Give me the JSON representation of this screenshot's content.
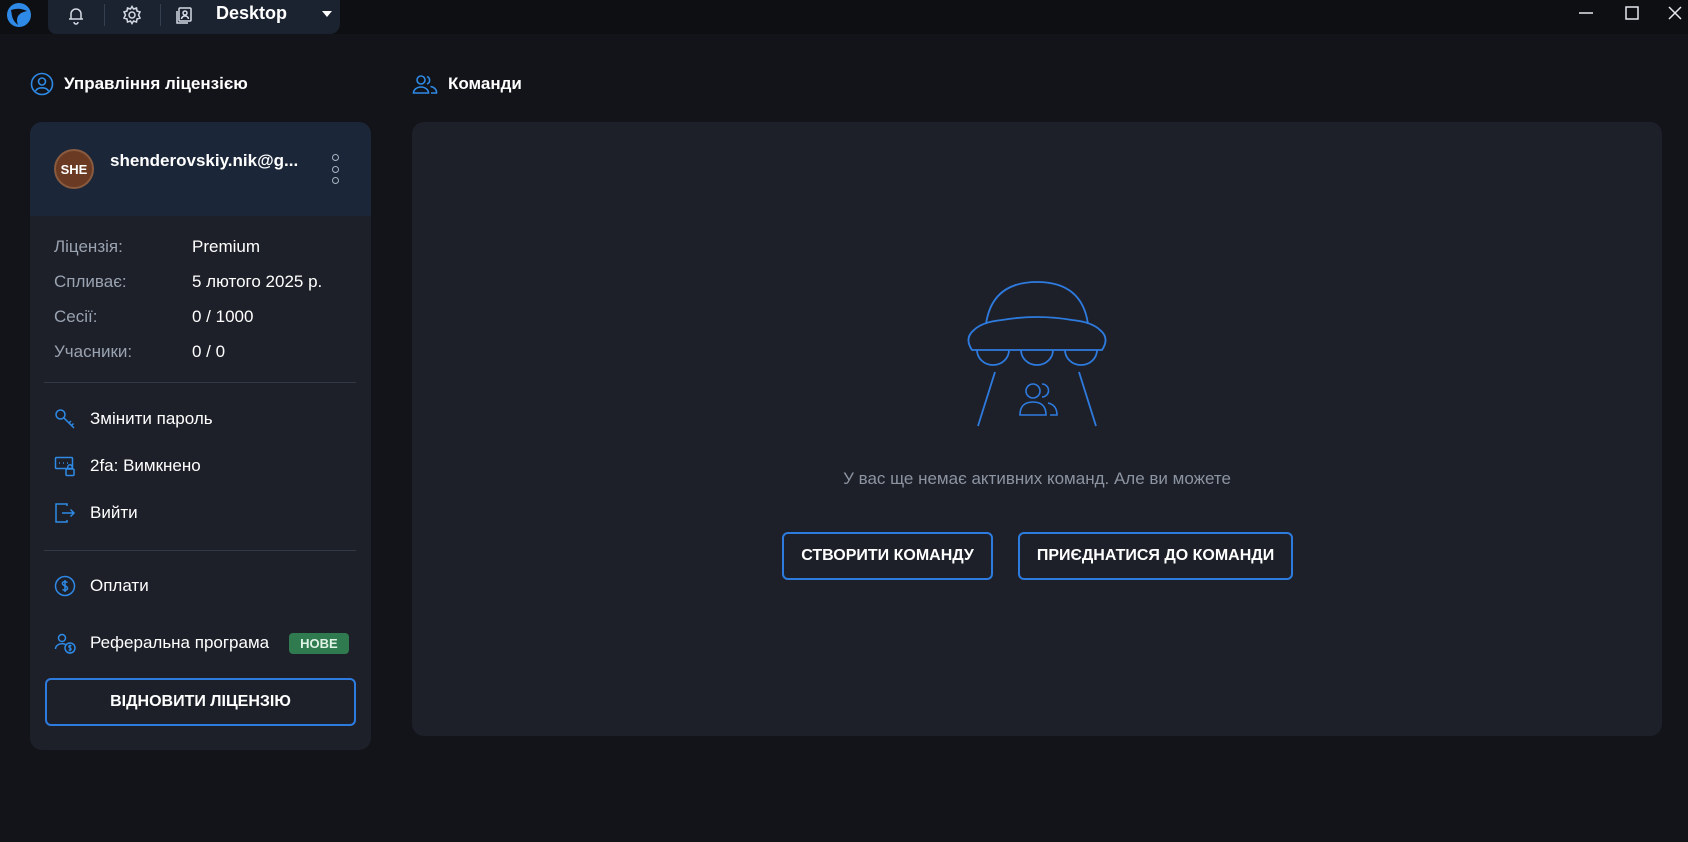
{
  "titlebar": {
    "desktop_label": "Desktop",
    "icons": [
      "app-logo-icon",
      "bell-icon",
      "gear-icon",
      "user-card-icon",
      "caret-down-icon"
    ],
    "window_controls": [
      "minimize-icon",
      "maximize-icon",
      "close-icon"
    ]
  },
  "license": {
    "header": "Управління ліцензією",
    "avatar_initials": "SHE",
    "email": "shenderovskiy.nik@g...",
    "rows": [
      {
        "label": "Ліцензія:",
        "value": "Premium"
      },
      {
        "label": "Спливає:",
        "value": "5 лютого 2025 р."
      },
      {
        "label": "Сесії:",
        "value": "0 / 1000"
      },
      {
        "label": "Учасники:",
        "value": "0 / 0"
      }
    ],
    "menu": {
      "change_password": "Змінити пароль",
      "two_fa": "2fa: Вимкнено",
      "logout": "Вийти",
      "payments": "Оплати",
      "referral": "Реферальна програма",
      "referral_badge": "НОВЕ"
    },
    "renew_button": "ВІДНОВИТИ ЛІЦЕНЗІЮ"
  },
  "teams": {
    "header": "Команди",
    "empty_text": "У вас ще немає активних команд. Але ви можете",
    "create_button": "СТВОРИТИ КОМАНДУ",
    "join_button": "ПРИЄДНАТИСЯ ДО КОМАНДИ"
  },
  "colors": {
    "background": "#121419",
    "card": "#1d2029",
    "accent": "#2e7be0",
    "badge_green": "#2f7a4e"
  }
}
